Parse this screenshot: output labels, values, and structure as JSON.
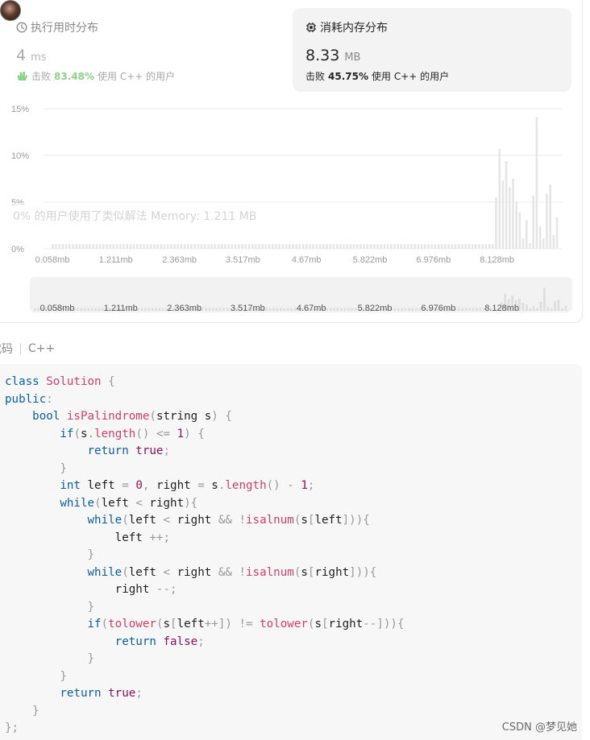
{
  "runtime": {
    "title": "执行用时分布",
    "value": "4",
    "unit": "ms",
    "beat_prefix": "击败",
    "beat_pct": "83.48%",
    "beat_suffix": "使用 C++ 的用户"
  },
  "memory": {
    "title": "消耗内存分布",
    "value": "8.33",
    "unit": "MB",
    "beat_prefix": "击败",
    "beat_pct": "45.75%",
    "beat_suffix": "使用 C++ 的用户"
  },
  "tooltip": "0% 的用户使用了类似解法 Memory: 1.211 MB",
  "chart_data": {
    "type": "bar",
    "y_ticks": [
      "15%",
      "10%",
      "5%",
      "0%"
    ],
    "ylim": [
      0,
      15
    ],
    "x_tick_labels": [
      "0.058mb",
      "1.211mb",
      "2.363mb",
      "3.517mb",
      "4.67mb",
      "5.822mb",
      "6.976mb",
      "8.128mb"
    ],
    "values": [
      0.5,
      0.5,
      0.5,
      0.5,
      0.5,
      0.5,
      0.5,
      0.5,
      0.5,
      0.5,
      0.5,
      0.5,
      0.5,
      0.5,
      0.5,
      0.5,
      0.5,
      0.5,
      0.5,
      0.5,
      0.5,
      0.5,
      0.5,
      0.5,
      0.5,
      0.5,
      0.5,
      0.5,
      0.5,
      0.5,
      0.5,
      0.5,
      0.5,
      0.5,
      0.5,
      0.5,
      0.5,
      0.5,
      0.5,
      0.5,
      0.5,
      0.5,
      0.5,
      0.5,
      0.5,
      0.5,
      0.5,
      0.5,
      0.5,
      0.5,
      0.5,
      0.5,
      0.5,
      0.5,
      0.5,
      0.5,
      0.5,
      0.5,
      0.5,
      0.5,
      0.5,
      0.5,
      0.5,
      0.5,
      0.5,
      0.5,
      0.5,
      0.5,
      0.5,
      0.5,
      0.5,
      0.5,
      0.5,
      0.5,
      0.5,
      0.5,
      0.5,
      0.5,
      0.5,
      0.5,
      0.5,
      0.5,
      0.5,
      0.5,
      0.5,
      0.5,
      0.5,
      0.5,
      0.5,
      0.5,
      0.5,
      0.5,
      0.5,
      0.5,
      0.5,
      0.5,
      0.5,
      0.5,
      0.5,
      0.5,
      0.5,
      0.5,
      0.5,
      0.5,
      0.5,
      0.5,
      0.5,
      0.5,
      0.5,
      0.5,
      0.5,
      0.5,
      0.5,
      0.5,
      0.5,
      0.5,
      0.5,
      0.5,
      0.5,
      0.5,
      0.5,
      0.5,
      0.5,
      0.5,
      0.5,
      0.5,
      0.5,
      0.5,
      0.5,
      0.5,
      0.5,
      5.5,
      10.7,
      7.3,
      9.4,
      6.6,
      7.5,
      5.0,
      3.9,
      1.1,
      3.1,
      0.6,
      5.7,
      14.1,
      2.4,
      1.1,
      5.9,
      6.9,
      1.5,
      3.4
    ],
    "highlight_index": 150,
    "grid": true
  },
  "code_header": {
    "label": "代码",
    "language": "C++"
  },
  "code": {
    "lines": [
      [
        [
          "k",
          "class"
        ],
        [
          "n",
          " "
        ],
        [
          "t",
          "Solution"
        ],
        [
          "n",
          " "
        ],
        [
          "p",
          "{"
        ]
      ],
      [
        [
          "k",
          "public"
        ],
        [
          "p",
          ":"
        ]
      ],
      [
        [
          "n",
          "    "
        ],
        [
          "k",
          "bool"
        ],
        [
          "n",
          " "
        ],
        [
          "fn",
          "isPalindrome"
        ],
        [
          "p",
          "("
        ],
        [
          "n",
          "string s"
        ],
        [
          "p",
          ")"
        ],
        [
          "n",
          " "
        ],
        [
          "p",
          "{"
        ]
      ],
      [
        [
          "n",
          "        "
        ],
        [
          "k",
          "if"
        ],
        [
          "p",
          "("
        ],
        [
          "n",
          "s"
        ],
        [
          "p",
          "."
        ],
        [
          "fn",
          "length"
        ],
        [
          "p",
          "()"
        ],
        [
          "n",
          " "
        ],
        [
          "p",
          "<="
        ],
        [
          "n",
          " "
        ],
        [
          "lit",
          "1"
        ],
        [
          "p",
          ")"
        ],
        [
          "n",
          " "
        ],
        [
          "p",
          "{"
        ]
      ],
      [
        [
          "n",
          "            "
        ],
        [
          "k",
          "return"
        ],
        [
          "n",
          " "
        ],
        [
          "lit",
          "true"
        ],
        [
          "p",
          ";"
        ]
      ],
      [
        [
          "n",
          "        "
        ],
        [
          "p",
          "}"
        ]
      ],
      [
        [
          "n",
          "        "
        ],
        [
          "k",
          "int"
        ],
        [
          "n",
          " left "
        ],
        [
          "p",
          "="
        ],
        [
          "n",
          " "
        ],
        [
          "lit",
          "0"
        ],
        [
          "p",
          ","
        ],
        [
          "n",
          " right "
        ],
        [
          "p",
          "="
        ],
        [
          "n",
          " s"
        ],
        [
          "p",
          "."
        ],
        [
          "fn",
          "length"
        ],
        [
          "p",
          "()"
        ],
        [
          "n",
          " "
        ],
        [
          "p",
          "-"
        ],
        [
          "n",
          " "
        ],
        [
          "lit",
          "1"
        ],
        [
          "p",
          ";"
        ]
      ],
      [
        [
          "n",
          "        "
        ],
        [
          "k",
          "while"
        ],
        [
          "p",
          "("
        ],
        [
          "n",
          "left "
        ],
        [
          "p",
          "<"
        ],
        [
          "n",
          " right"
        ],
        [
          "p",
          ")"
        ],
        [
          "p",
          "{"
        ]
      ],
      [
        [
          "n",
          "            "
        ],
        [
          "k",
          "while"
        ],
        [
          "p",
          "("
        ],
        [
          "n",
          "left "
        ],
        [
          "p",
          "<"
        ],
        [
          "n",
          " right "
        ],
        [
          "p",
          "&&"
        ],
        [
          "n",
          " "
        ],
        [
          "p",
          "!"
        ],
        [
          "fn",
          "isalnum"
        ],
        [
          "p",
          "("
        ],
        [
          "n",
          "s"
        ],
        [
          "p",
          "["
        ],
        [
          "n",
          "left"
        ],
        [
          "p",
          "]))"
        ],
        [
          "p",
          "{"
        ]
      ],
      [
        [
          "n",
          "                left "
        ],
        [
          "p",
          "++;"
        ]
      ],
      [
        [
          "n",
          "            "
        ],
        [
          "p",
          "}"
        ]
      ],
      [
        [
          "n",
          "            "
        ],
        [
          "k",
          "while"
        ],
        [
          "p",
          "("
        ],
        [
          "n",
          "left "
        ],
        [
          "p",
          "<"
        ],
        [
          "n",
          " right "
        ],
        [
          "p",
          "&&"
        ],
        [
          "n",
          " "
        ],
        [
          "p",
          "!"
        ],
        [
          "fn",
          "isalnum"
        ],
        [
          "p",
          "("
        ],
        [
          "n",
          "s"
        ],
        [
          "p",
          "["
        ],
        [
          "n",
          "right"
        ],
        [
          "p",
          "]))"
        ],
        [
          "p",
          "{"
        ]
      ],
      [
        [
          "n",
          "                right "
        ],
        [
          "p",
          "--;"
        ]
      ],
      [
        [
          "n",
          "            "
        ],
        [
          "p",
          "}"
        ]
      ],
      [
        [
          "n",
          "            "
        ],
        [
          "k",
          "if"
        ],
        [
          "p",
          "("
        ],
        [
          "fn",
          "tolower"
        ],
        [
          "p",
          "("
        ],
        [
          "n",
          "s"
        ],
        [
          "p",
          "["
        ],
        [
          "n",
          "left"
        ],
        [
          "p",
          "++])"
        ],
        [
          "n",
          " "
        ],
        [
          "p",
          "!="
        ],
        [
          "n",
          " "
        ],
        [
          "fn",
          "tolower"
        ],
        [
          "p",
          "("
        ],
        [
          "n",
          "s"
        ],
        [
          "p",
          "["
        ],
        [
          "n",
          "right"
        ],
        [
          "p",
          "--]))"
        ],
        [
          "p",
          "{"
        ]
      ],
      [
        [
          "n",
          "                "
        ],
        [
          "k",
          "return"
        ],
        [
          "n",
          " "
        ],
        [
          "lit",
          "false"
        ],
        [
          "p",
          ";"
        ]
      ],
      [
        [
          "n",
          "            "
        ],
        [
          "p",
          "}"
        ]
      ],
      [
        [
          "n",
          "        "
        ],
        [
          "p",
          "}"
        ]
      ],
      [
        [
          "n",
          "        "
        ],
        [
          "k",
          "return"
        ],
        [
          "n",
          " "
        ],
        [
          "lit",
          "true"
        ],
        [
          "p",
          ";"
        ]
      ],
      [
        [
          "n",
          "    "
        ],
        [
          "p",
          "}"
        ]
      ],
      [
        [
          "p",
          "};"
        ]
      ]
    ]
  },
  "watermark": "CSDN @梦见她",
  "colors": {
    "bar": "#e6e6e6",
    "bar_highlight": "#1f1f1f",
    "beat_green": "#8fd18a",
    "keyword": "#0b5fa0",
    "function": "#cf3e6a"
  }
}
